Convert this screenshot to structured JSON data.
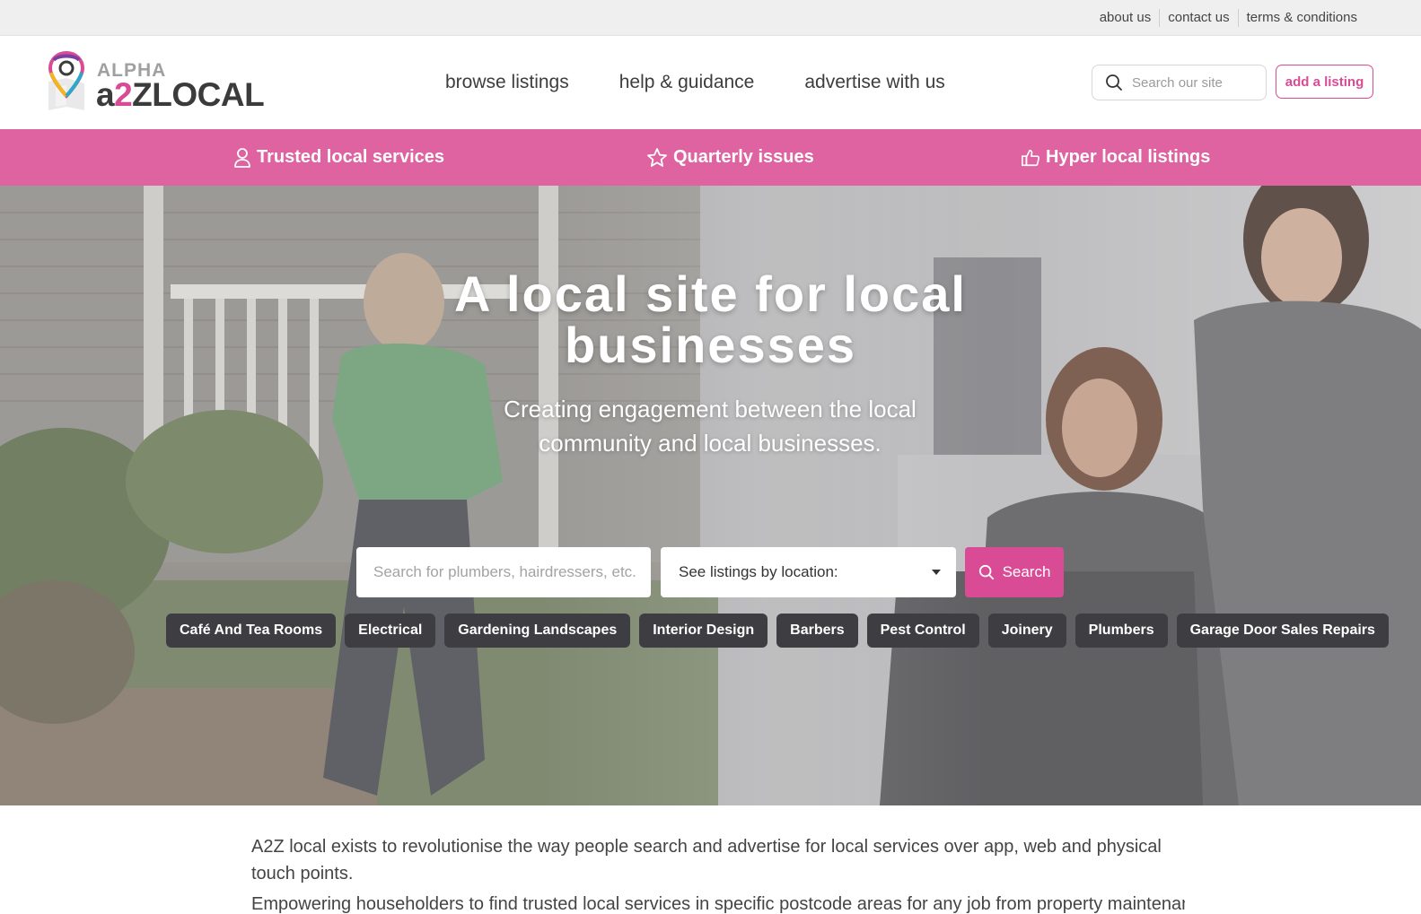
{
  "utility_nav": {
    "about": "about us",
    "contact": "contact us",
    "terms": "terms & conditions"
  },
  "logo": {
    "alpha": "ALPHA",
    "a": "a",
    "two": "2",
    "z": "Z",
    "local": "LOCAL"
  },
  "main_nav": {
    "browse": "browse listings",
    "help": "help & guidance",
    "advertise": "advertise with us"
  },
  "header": {
    "search_placeholder": "Search our site",
    "add_listing": "add a listing"
  },
  "features": {
    "trusted": "Trusted local services",
    "quarterly": "Quarterly issues",
    "hyper": "Hyper local listings"
  },
  "hero": {
    "title_line1": "A local site for local",
    "title_line2": "businesses",
    "subtitle": "Creating engagement between the local community and local businesses.",
    "search_placeholder": "Search for plumbers, hairdressers, etc.",
    "location_label": "See listings by location:",
    "search_button": "Search"
  },
  "categories": [
    "Café And Tea Rooms",
    "Electrical",
    "Gardening Landscapes",
    "Interior Design",
    "Barbers",
    "Pest Control",
    "Joinery",
    "Plumbers",
    "Garage Door Sales Repairs"
  ],
  "intro": {
    "paragraph1": "A2Z local exists to revolutionise the way people search and advertise for local services over app, web and physical touch points.",
    "paragraph2": "Empowering householders to find trusted local services in specific postcode areas for any job from property maintenance to IT"
  },
  "colors": {
    "brand_pink": "#d94b95",
    "band_pink": "#de63a0",
    "chip_dark": "#3e3d42"
  },
  "icons": [
    "search-icon",
    "user-icon",
    "star-icon",
    "thumbs-up-icon",
    "map-pin-icon",
    "caret-down-icon"
  ]
}
